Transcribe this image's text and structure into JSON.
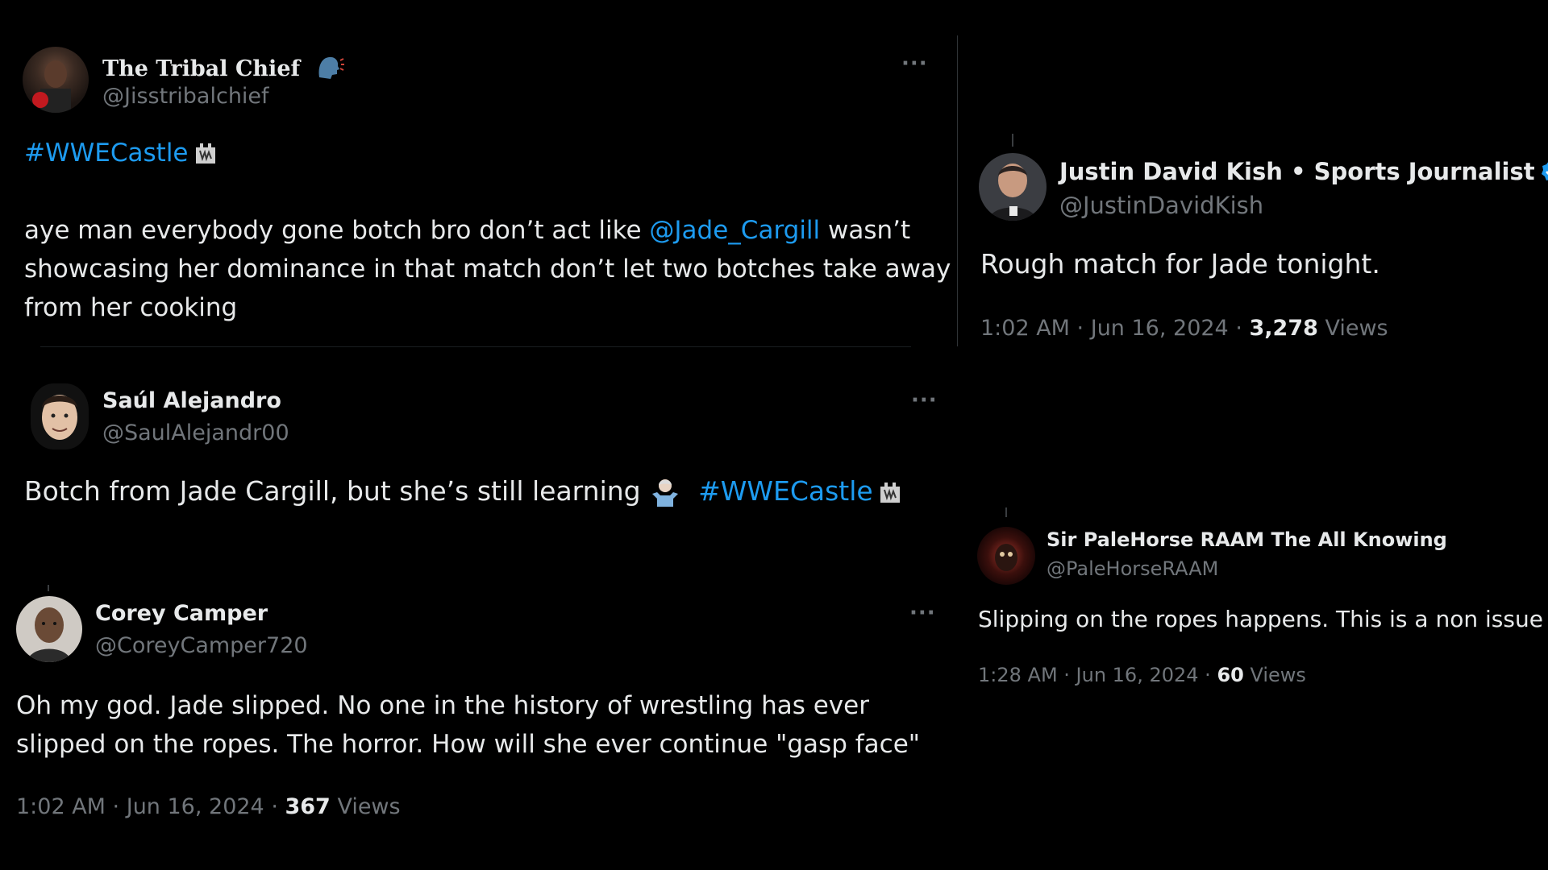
{
  "tweets": [
    {
      "name": "The Tribal Chief",
      "handle": "@Jisstribalchief",
      "hashtag": "#WWECastle",
      "text_1": "aye man everybody gone botch bro don’t act like ",
      "mention": "@Jade_Cargill",
      "text_2": " wasn’t",
      "line_2": "showcasing her dominance in that match don’t let two botches take away",
      "line_3": "from her cooking",
      "more": "···"
    },
    {
      "name": "Saúl Alejandro",
      "handle": "@SaulAlejandr00",
      "text": "Botch from Jade Cargill, but she’s still learning",
      "hashtag": "#WWECastle",
      "more": "···"
    },
    {
      "name": "Corey Camper",
      "handle": "@CoreyCamper720",
      "line_1": "Oh my god. Jade slipped. No one in the history of wrestling has ever",
      "line_2": "slipped on the ropes. The horror. How will she ever continue \"gasp face\"",
      "time": "1:02 AM · Jun 16, 2024 · ",
      "views_count": "367",
      "views_label": " Views",
      "more": "···"
    },
    {
      "name": "Justin David Kish • Sports Journalist",
      "handle": "@JustinDavidKish",
      "text": "Rough match for Jade tonight.",
      "time": "1:02 AM · Jun 16, 2024 · ",
      "views_count": "3,278",
      "views_label": " Views"
    },
    {
      "name": "Sir PaleHorse RAAM The All Knowing",
      "handle": "@PaleHorseRAAM",
      "text": "Slipping on the ropes happens. This is a non issue",
      "time": "1:28 AM · Jun 16, 2024 · ",
      "views_count": "60",
      "views_label": " Views"
    }
  ],
  "colors": {
    "background": "#000000",
    "text": "#e7e9ea",
    "muted": "#71767b",
    "link": "#1d9bf0",
    "verified": "#1d9bf0"
  },
  "icons": [
    "speaking-head-icon",
    "castle-icon",
    "person-shrugging-icon",
    "verified-badge-icon",
    "more-options-icon"
  ]
}
